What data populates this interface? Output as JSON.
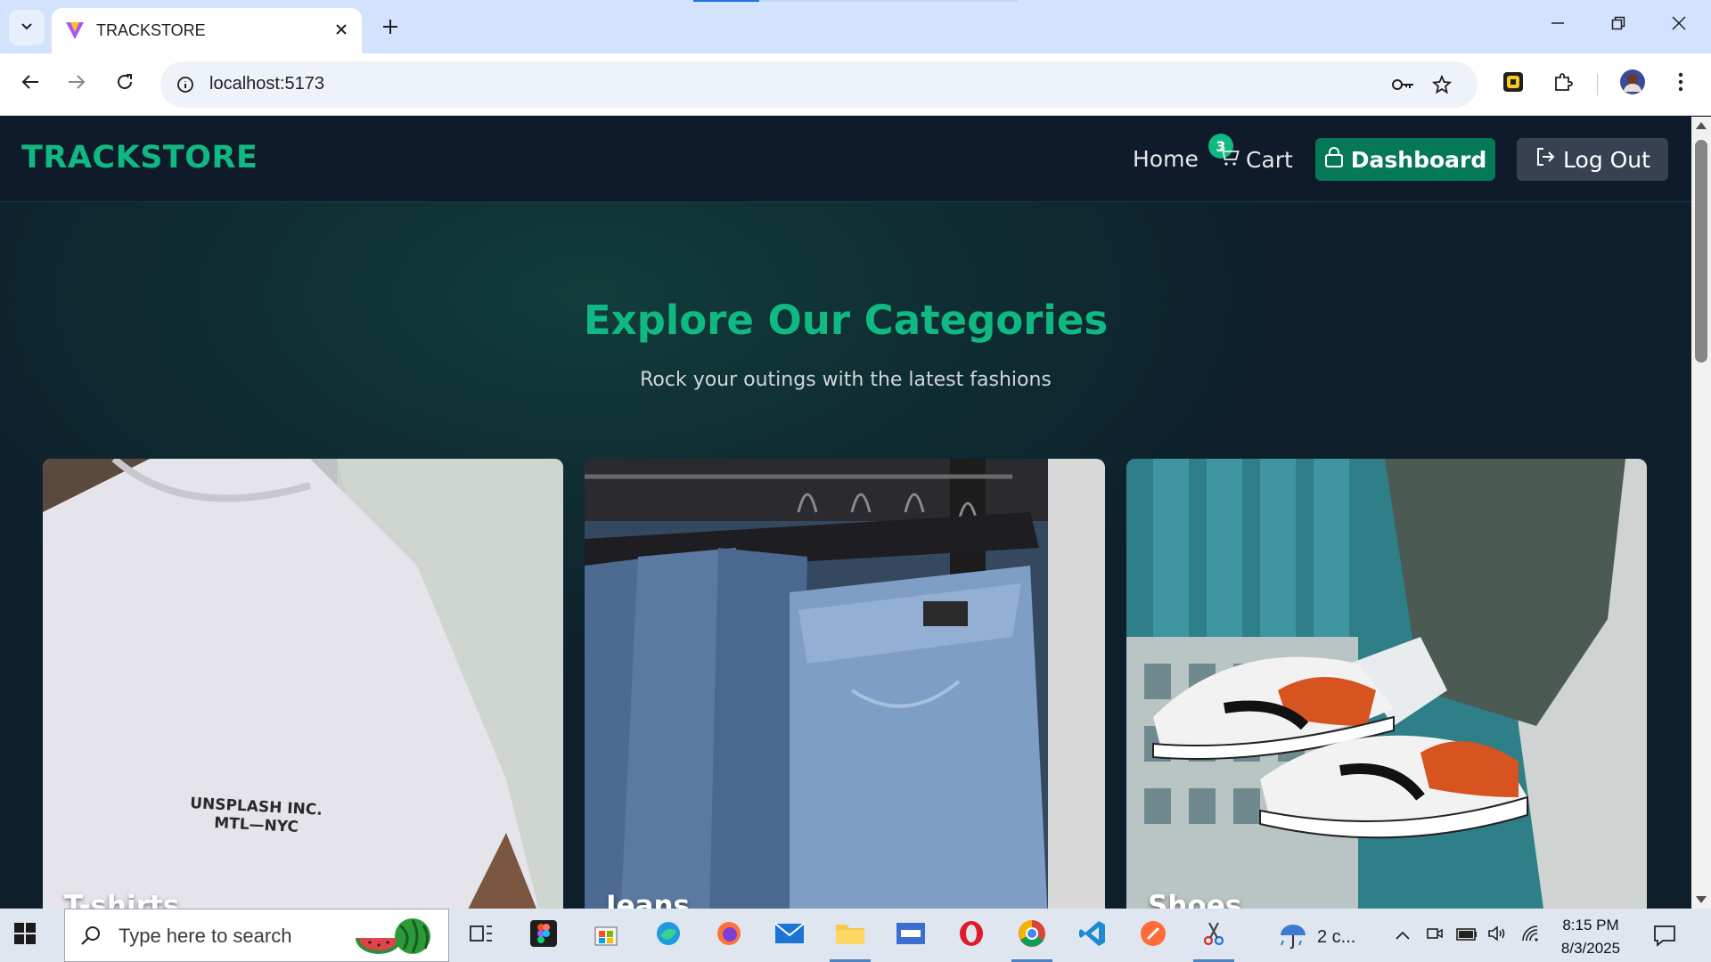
{
  "browser": {
    "tab_title": "TRACKSTORE",
    "url": "localhost:5173"
  },
  "app": {
    "brand": "TRACKSTORE",
    "nav": {
      "home": "Home",
      "cart": "Cart",
      "cart_count": "3",
      "dashboard": "Dashboard",
      "logout": "Log Out"
    },
    "hero": {
      "title": "Explore Our Categories",
      "subtitle": "Rock your outings with the latest fashions"
    },
    "categories": [
      {
        "label": "T-shirts",
        "print_line1": "UNSPLASH INC.",
        "print_line2": "MTL—NYC"
      },
      {
        "label": "Jeans"
      },
      {
        "label": "Shoes"
      }
    ]
  },
  "taskbar": {
    "search_placeholder": "Type here to search",
    "weather": "2 c...",
    "time": "8:15 PM",
    "date": "8/3/2025"
  },
  "colors": {
    "brand_green": "#10b981",
    "dashboard_button": "#047857",
    "logout_button": "#374151",
    "header_bg": "#0f1a2b"
  }
}
